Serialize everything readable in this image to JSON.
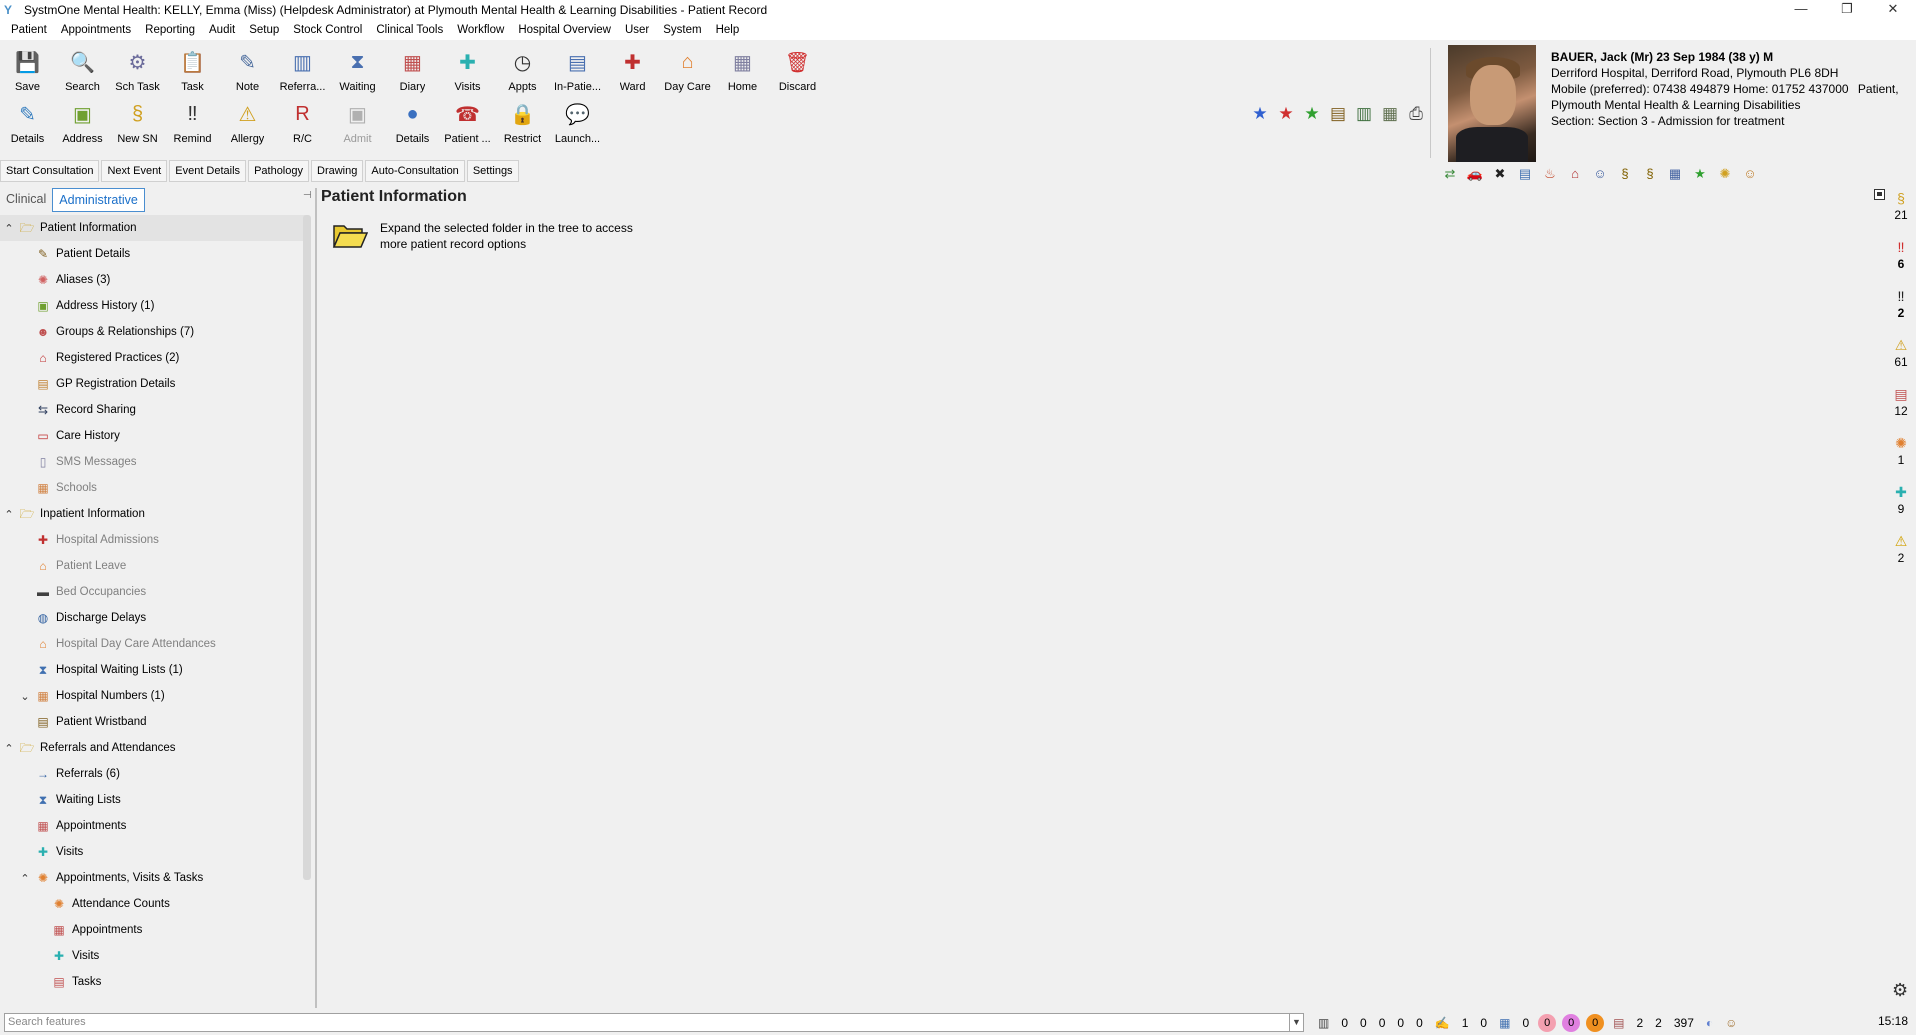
{
  "window": {
    "title": "SystmOne Mental Health: KELLY, Emma (Miss) (Helpdesk Administrator) at Plymouth Mental Health & Learning Disabilities - Patient Record",
    "controls": {
      "minimize": "—",
      "restore": "❐",
      "close": "✕"
    }
  },
  "menu": [
    "Patient",
    "Appointments",
    "Reporting",
    "Audit",
    "Setup",
    "Stock Control",
    "Clinical Tools",
    "Workflow",
    "Hospital Overview",
    "User",
    "System",
    "Help"
  ],
  "toolbar": {
    "row1": [
      {
        "label": "Save",
        "icon": "save-icon",
        "glyph": "💾",
        "color": "#3a9e3a"
      },
      {
        "label": "Search",
        "icon": "search-icon",
        "glyph": "🔍",
        "color": "#555"
      },
      {
        "label": "Sch Task",
        "icon": "scheduled-task-icon",
        "glyph": "⚙",
        "color": "#6a6a9a"
      },
      {
        "label": "Task",
        "icon": "task-icon",
        "glyph": "📋",
        "color": "#c8a030"
      },
      {
        "label": "Note",
        "icon": "note-icon",
        "glyph": "✎",
        "color": "#5070a0"
      },
      {
        "label": "Referra...",
        "icon": "referral-icon",
        "glyph": "▥",
        "color": "#4a70b0"
      },
      {
        "label": "Waiting",
        "icon": "waiting-icon",
        "glyph": "⧗",
        "color": "#4a70b0"
      },
      {
        "label": "Diary",
        "icon": "diary-icon",
        "glyph": "▦",
        "color": "#c05050"
      },
      {
        "label": "Visits",
        "icon": "visits-icon",
        "glyph": "✚",
        "color": "#2ab0b0"
      },
      {
        "label": "Appts",
        "icon": "appointments-icon",
        "glyph": "◷",
        "color": "#333"
      },
      {
        "label": "In-Patie...",
        "icon": "inpatient-icon",
        "glyph": "▤",
        "color": "#4a70b0"
      },
      {
        "label": "Ward",
        "icon": "ward-icon",
        "glyph": "✚",
        "color": "#c03030"
      },
      {
        "label": "Day Care",
        "icon": "day-care-icon",
        "glyph": "⌂",
        "color": "#e08030"
      },
      {
        "label": "Home",
        "icon": "home-icon",
        "glyph": "▦",
        "color": "#8080a0"
      },
      {
        "label": "Discard",
        "icon": "discard-icon",
        "glyph": "🗑",
        "color": "#d03030"
      }
    ],
    "row2": [
      {
        "label": "Details",
        "icon": "patient-details-icon",
        "glyph": "✎",
        "color": "#3a80c0",
        "disabled": false
      },
      {
        "label": "Address",
        "icon": "address-icon",
        "glyph": "▣",
        "color": "#70a030",
        "disabled": false
      },
      {
        "label": "New SN",
        "icon": "new-sn-icon",
        "glyph": "§",
        "color": "#d0a020",
        "disabled": false
      },
      {
        "label": "Remind",
        "icon": "remind-icon",
        "glyph": "‼",
        "color": "#333",
        "disabled": false
      },
      {
        "label": "Allergy",
        "icon": "allergy-icon",
        "glyph": "⚠",
        "color": "#d0a020",
        "disabled": false
      },
      {
        "label": "R/C",
        "icon": "rc-icon",
        "glyph": "R",
        "color": "#c03030",
        "disabled": false
      },
      {
        "label": "Admit",
        "icon": "admit-icon",
        "glyph": "▣",
        "color": "#b0b0b0",
        "disabled": true
      },
      {
        "label": "Details",
        "icon": "details-globe-icon",
        "glyph": "●",
        "color": "#3a70c0",
        "disabled": false
      },
      {
        "label": "Patient ...",
        "icon": "patient-app-icon",
        "glyph": "☎",
        "color": "#c03030",
        "disabled": false
      },
      {
        "label": "Restrict",
        "icon": "restrict-icon",
        "glyph": "🔒",
        "color": "#c0a020",
        "disabled": false
      },
      {
        "label": "Launch...",
        "icon": "launch-icon",
        "glyph": "💬",
        "color": "#8080d0",
        "disabled": false
      }
    ]
  },
  "quickbar": [
    {
      "icon": "blue-star-icon",
      "glyph": "★",
      "color": "#3060d0"
    },
    {
      "icon": "red-star-icon",
      "glyph": "★",
      "color": "#d03030"
    },
    {
      "icon": "green-star-icon",
      "glyph": "★",
      "color": "#30a030"
    },
    {
      "icon": "document-icon",
      "glyph": "▤",
      "color": "#806020"
    },
    {
      "icon": "print-preview-icon",
      "glyph": "▥",
      "color": "#407040"
    },
    {
      "icon": "print-setup-icon",
      "glyph": "▦",
      "color": "#607050"
    },
    {
      "icon": "printer-icon",
      "glyph": "⎙",
      "color": "#444"
    }
  ],
  "patient": {
    "name_line": "BAUER, Jack (Mr) 23 Sep 1984 (38 y) M",
    "address": "Derriford Hospital, Derriford Road, Plymouth PL6 8DH",
    "phones": "Mobile (preferred): 07438 494879 Home: 01752 437000",
    "patient_label": "Patient,",
    "org": "Plymouth Mental Health & Learning Disabilities",
    "section": "Section: Section 3 - Admission for treatment",
    "icons": [
      {
        "icon": "relationship-icon",
        "glyph": "⇄",
        "color": "#3a8a3a"
      },
      {
        "icon": "car-icon",
        "glyph": "🚗",
        "color": "#4060a0"
      },
      {
        "icon": "cross-icon",
        "glyph": "✖",
        "color": "#222"
      },
      {
        "icon": "record-icon",
        "glyph": "▤",
        "color": "#4070b0"
      },
      {
        "icon": "bottle-icon",
        "glyph": "♨",
        "color": "#c04020"
      },
      {
        "icon": "house-icon",
        "glyph": "⌂",
        "color": "#b03030"
      },
      {
        "icon": "person-icon",
        "glyph": "☺",
        "color": "#4060a0"
      },
      {
        "icon": "sn-icon",
        "glyph": "§",
        "color": "#806000"
      },
      {
        "icon": "sn-alt-icon",
        "glyph": "§",
        "color": "#806000"
      },
      {
        "icon": "calendar-icon",
        "glyph": "▦",
        "color": "#4060a0"
      },
      {
        "icon": "green-star-icon",
        "glyph": "★",
        "color": "#30a030"
      },
      {
        "icon": "sun-icon",
        "glyph": "✺",
        "color": "#d0a020"
      },
      {
        "icon": "user-icon",
        "glyph": "☺",
        "color": "#c08030"
      }
    ]
  },
  "buttons": [
    "Start Consultation",
    "Next Event",
    "Event Details",
    "Pathology",
    "Drawing",
    "Auto-Consultation",
    "Settings"
  ],
  "tabs": {
    "clinical": "Clinical",
    "administrative": "Administrative"
  },
  "tree": [
    {
      "level": 0,
      "arrow": "⌃",
      "icon": "folder-open-icon",
      "glyph": "🗁",
      "color": "#c8a020",
      "label": "Patient Information",
      "grey": false,
      "selected": true
    },
    {
      "level": 1,
      "arrow": "",
      "icon": "patient-details-icon",
      "glyph": "✎",
      "color": "#806020",
      "label": "Patient Details",
      "grey": false
    },
    {
      "level": 1,
      "arrow": "",
      "icon": "aliases-icon",
      "glyph": "✺",
      "color": "#d06060",
      "label": "Aliases (3)",
      "grey": false
    },
    {
      "level": 1,
      "arrow": "",
      "icon": "address-history-icon",
      "glyph": "▣",
      "color": "#70a030",
      "label": "Address History (1)",
      "grey": false
    },
    {
      "level": 1,
      "arrow": "",
      "icon": "groups-icon",
      "glyph": "☻",
      "color": "#c05050",
      "label": "Groups & Relationships (7)",
      "grey": false
    },
    {
      "level": 1,
      "arrow": "",
      "icon": "registered-practices-icon",
      "glyph": "⌂",
      "color": "#c03030",
      "label": "Registered Practices (2)",
      "grey": false
    },
    {
      "level": 1,
      "arrow": "",
      "icon": "gp-registration-icon",
      "glyph": "▤",
      "color": "#c08030",
      "label": "GP Registration Details",
      "grey": false
    },
    {
      "level": 1,
      "arrow": "",
      "icon": "record-sharing-icon",
      "glyph": "⇆",
      "color": "#304060",
      "label": "Record Sharing",
      "grey": false
    },
    {
      "level": 1,
      "arrow": "",
      "icon": "care-history-icon",
      "glyph": "▭",
      "color": "#c03030",
      "label": "Care History",
      "grey": false
    },
    {
      "level": 1,
      "arrow": "",
      "icon": "sms-icon",
      "glyph": "▯",
      "color": "#8080a0",
      "label": "SMS Messages",
      "grey": true
    },
    {
      "level": 1,
      "arrow": "",
      "icon": "schools-icon",
      "glyph": "▦",
      "color": "#d08040",
      "label": "Schools",
      "grey": true
    },
    {
      "level": 0,
      "arrow": "⌃",
      "icon": "folder-open-icon",
      "glyph": "🗁",
      "color": "#c8a020",
      "label": "Inpatient Information",
      "grey": false
    },
    {
      "level": 1,
      "arrow": "",
      "icon": "hospital-admissions-icon",
      "glyph": "✚",
      "color": "#c03030",
      "label": "Hospital Admissions",
      "grey": true
    },
    {
      "level": 1,
      "arrow": "",
      "icon": "patient-leave-icon",
      "glyph": "⌂",
      "color": "#e08030",
      "label": "Patient Leave",
      "grey": true
    },
    {
      "level": 1,
      "arrow": "",
      "icon": "bed-icon",
      "glyph": "▬",
      "color": "#404040",
      "label": "Bed Occupancies",
      "grey": true
    },
    {
      "level": 1,
      "arrow": "",
      "icon": "discharge-delays-icon",
      "glyph": "◍",
      "color": "#3060a0",
      "label": "Discharge Delays",
      "grey": false
    },
    {
      "level": 1,
      "arrow": "",
      "icon": "day-care-icon",
      "glyph": "⌂",
      "color": "#e08030",
      "label": "Hospital Day Care Attendances",
      "grey": true
    },
    {
      "level": 1,
      "arrow": "",
      "icon": "waiting-lists-icon",
      "glyph": "⧗",
      "color": "#4070b0",
      "label": "Hospital Waiting Lists (1)",
      "grey": false
    },
    {
      "level": 1,
      "arrow": "⌄",
      "icon": "hospital-numbers-icon",
      "glyph": "▦",
      "color": "#d08040",
      "label": "Hospital Numbers (1)",
      "grey": false
    },
    {
      "level": 1,
      "arrow": "",
      "icon": "wristband-icon",
      "glyph": "▤",
      "color": "#806020",
      "label": "Patient Wristband",
      "grey": false
    },
    {
      "level": 0,
      "arrow": "⌃",
      "icon": "folder-open-icon",
      "glyph": "🗁",
      "color": "#c8a020",
      "label": "Referrals and Attendances",
      "grey": false
    },
    {
      "level": 1,
      "arrow": "",
      "icon": "referrals-icon",
      "glyph": "→",
      "color": "#3060a0",
      "label": "Referrals (6)",
      "grey": false
    },
    {
      "level": 1,
      "arrow": "",
      "icon": "waiting-lists-icon",
      "glyph": "⧗",
      "color": "#4070b0",
      "label": "Waiting Lists",
      "grey": false
    },
    {
      "level": 1,
      "arrow": "",
      "icon": "appointments-icon",
      "glyph": "▦",
      "color": "#c05050",
      "label": "Appointments",
      "grey": false
    },
    {
      "level": 1,
      "arrow": "",
      "icon": "visits-icon",
      "glyph": "✚",
      "color": "#2ab0b0",
      "label": "Visits",
      "grey": false
    },
    {
      "level": 1,
      "arrow": "⌃",
      "icon": "avt-icon",
      "glyph": "✺",
      "color": "#e08030",
      "label": "Appointments, Visits & Tasks",
      "grey": false
    },
    {
      "level": 2,
      "arrow": "",
      "icon": "attendance-counts-icon",
      "glyph": "✺",
      "color": "#e08030",
      "label": "Attendance Counts",
      "grey": false
    },
    {
      "level": 2,
      "arrow": "",
      "icon": "appointments-icon",
      "glyph": "▦",
      "color": "#c05050",
      "label": "Appointments",
      "grey": false
    },
    {
      "level": 2,
      "arrow": "",
      "icon": "visits-icon",
      "glyph": "✚",
      "color": "#2ab0b0",
      "label": "Visits",
      "grey": false
    },
    {
      "level": 2,
      "arrow": "",
      "icon": "tasks-icon",
      "glyph": "▤",
      "color": "#c05050",
      "label": "Tasks",
      "grey": false
    }
  ],
  "content": {
    "heading": "Patient Information",
    "message": "Expand the selected folder in the tree to access more patient record options"
  },
  "right_strip": [
    {
      "icon": "sn-icon",
      "glyph": "§",
      "color": "#d0a020",
      "count": "21",
      "bold": false
    },
    {
      "icon": "alert-red-icon",
      "glyph": "‼",
      "color": "#d03030",
      "count": "6",
      "bold": true
    },
    {
      "icon": "alert-black-icon",
      "glyph": "‼",
      "color": "#222",
      "count": "2",
      "bold": true
    },
    {
      "icon": "allergy-icon",
      "glyph": "⚠",
      "color": "#d0a020",
      "count": "61",
      "bold": false
    },
    {
      "icon": "tasks-icon",
      "glyph": "▤",
      "color": "#c05050",
      "count": "12",
      "bold": false
    },
    {
      "icon": "sun-icon",
      "glyph": "✺",
      "color": "#e08030",
      "count": "1",
      "bold": false
    },
    {
      "icon": "visits-icon",
      "glyph": "✚",
      "color": "#2ab0b0",
      "count": "9",
      "bold": false
    },
    {
      "icon": "warning-icon",
      "glyph": "⚠",
      "color": "#d0a000",
      "count": "2",
      "bold": false
    }
  ],
  "statusbar": {
    "search_placeholder": "Search features",
    "counts_a": [
      "0",
      "0",
      "0",
      "0",
      "0"
    ],
    "count_b1": "1",
    "count_b2": "0",
    "count_c": "0",
    "badge_pink1": "0",
    "badge_pink2": "0",
    "badge_orange": "0",
    "count_d": [
      "2",
      "2",
      "397"
    ],
    "time": "15:18",
    "colors": {
      "pink1": "#f4a0b0",
      "pink2": "#e080e0",
      "orange": "#f09020"
    }
  }
}
